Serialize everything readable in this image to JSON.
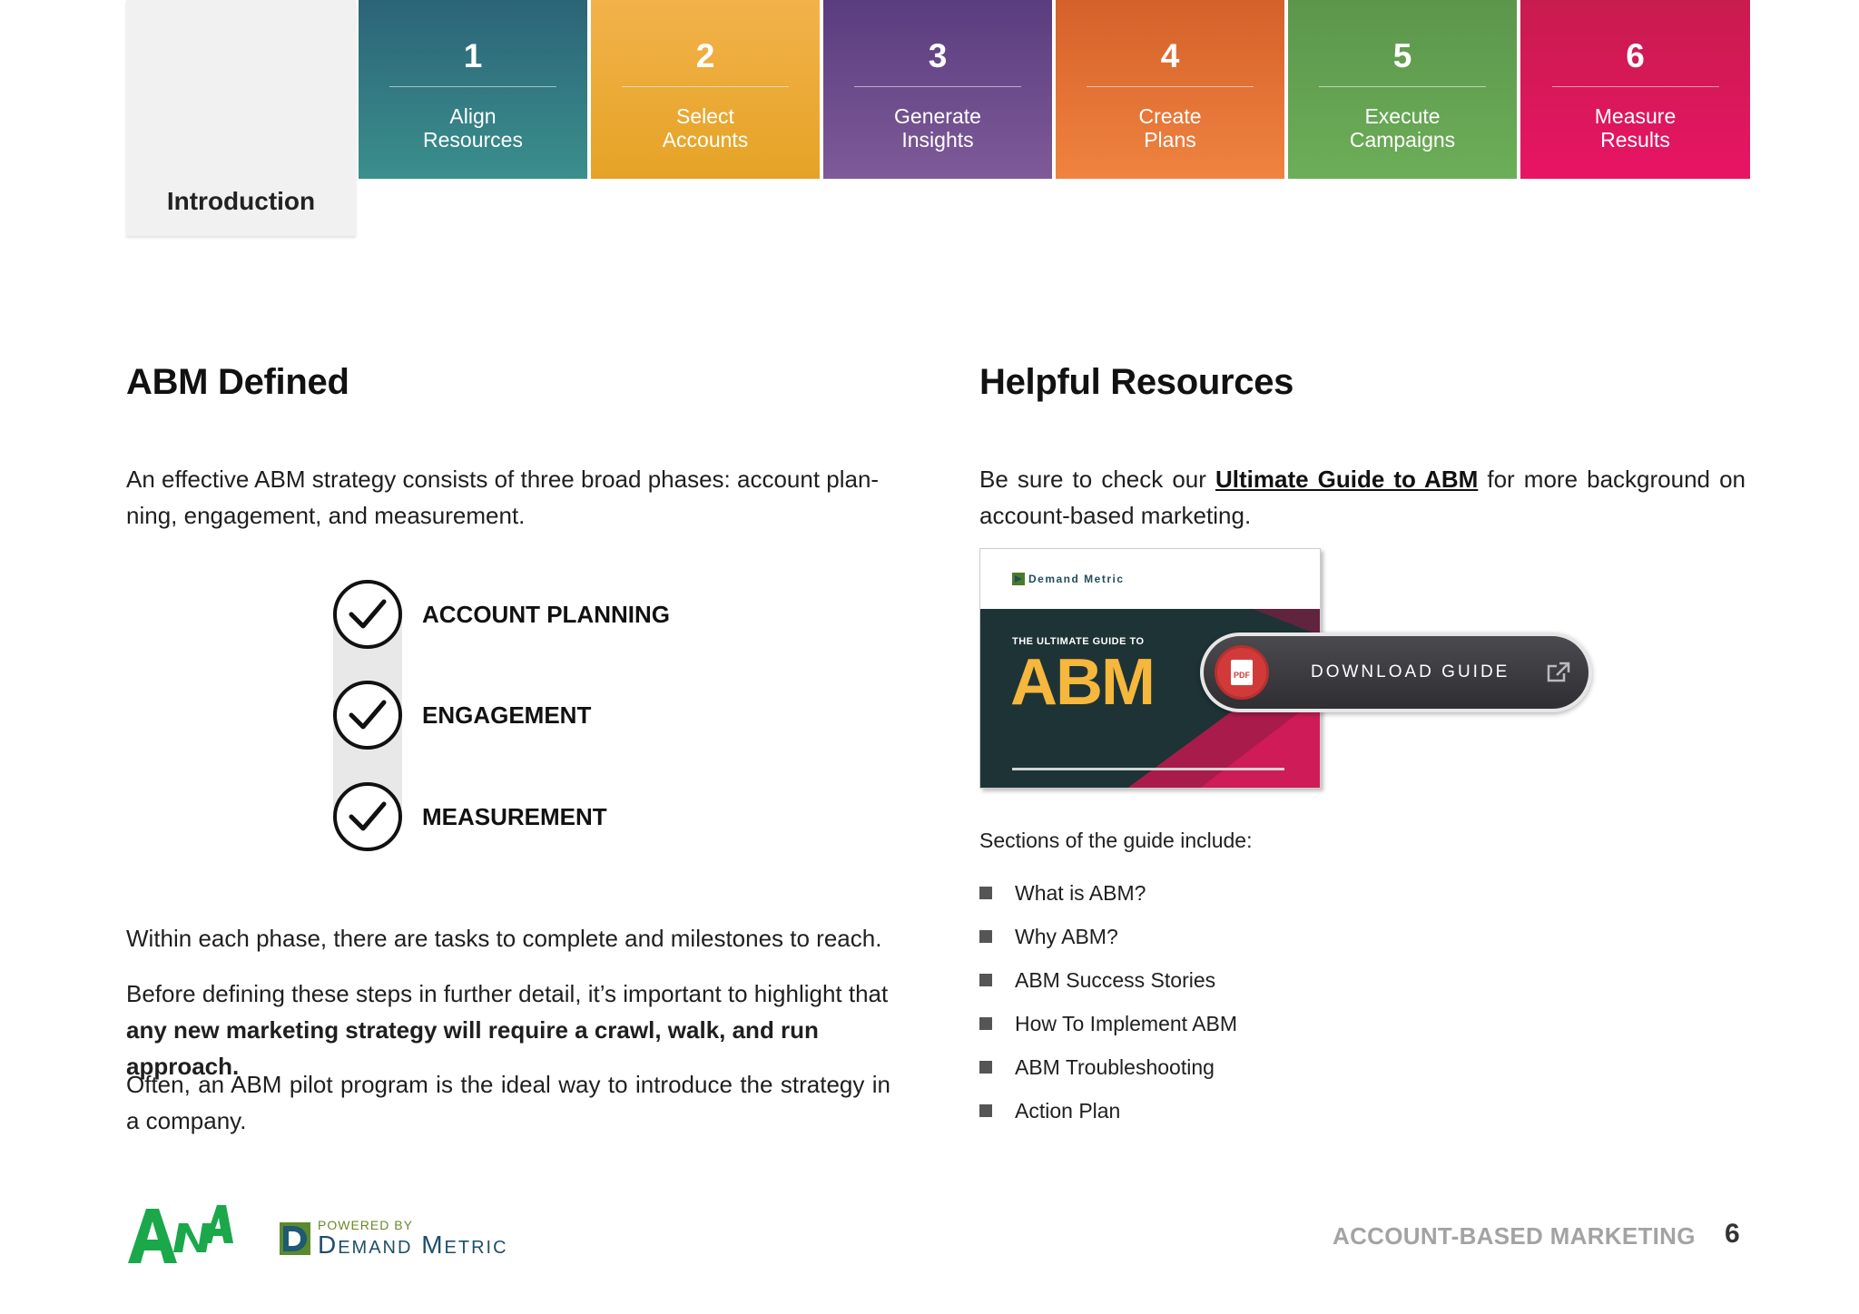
{
  "nav": {
    "intro_label": "Introduction",
    "steps": [
      {
        "number": "1",
        "label": "Align\nResources",
        "color": "#2f6f7e"
      },
      {
        "number": "2",
        "label": "Select\nAccounts",
        "color": "#eeab3a"
      },
      {
        "number": "3",
        "label": "Generate\nInsights",
        "color": "#6b4a8b"
      },
      {
        "number": "4",
        "label": "Create\nPlans",
        "color": "#e2702f"
      },
      {
        "number": "5",
        "label": "Execute\nCampaigns",
        "color": "#63a152"
      },
      {
        "number": "6",
        "label": "Measure\nResults",
        "color": "#d9185a"
      }
    ]
  },
  "left": {
    "heading": "ABM Defined",
    "intro": "An effective ABM strategy consists of three broad phases: account plan-ning, engagement, and measurement.",
    "phases": [
      "ACCOUNT PLANNING",
      "ENGAGEMENT",
      "MEASUREMENT"
    ],
    "p2": "Within each phase, there are tasks to complete and milestones to reach.",
    "p3_plain": "Before defining these steps in further detail, it’s important to highlight that ",
    "p3_bold": "any new marketing strategy will require a crawl, walk, and run approach.",
    "p4": "Often, an ABM pilot program is the ideal way to introduce the strategy in a company."
  },
  "right": {
    "heading": "Helpful Resources",
    "p1_before": "Be sure to check our ",
    "p1_link": "Ultimate Guide to ABM",
    "p1_after": " for more background on account-based marketing.",
    "cover": {
      "logo_text": "Demand Metric",
      "kicker": "THE ULTIMATE GUIDE TO",
      "title": "ABM"
    },
    "download_label": "DOWNLOAD GUIDE",
    "pdf_badge": "PDF",
    "sections_intro": "Sections of the guide include:",
    "sections": [
      "What is ABM?",
      "Why ABM?",
      "ABM Success Stories",
      "How To Implement ABM",
      "ABM Troubleshooting",
      "Action Plan"
    ]
  },
  "footer": {
    "ana_logo": "ANA",
    "powered_by": "POWERED BY",
    "dm_name": "Demand Metric",
    "title": "ACCOUNT-BASED MARKETING",
    "page_number": "6"
  },
  "colors": {
    "accent_gold": "#f5b73c",
    "ana_green": "#1aa84a",
    "footer_gray": "#a3a3a3"
  }
}
